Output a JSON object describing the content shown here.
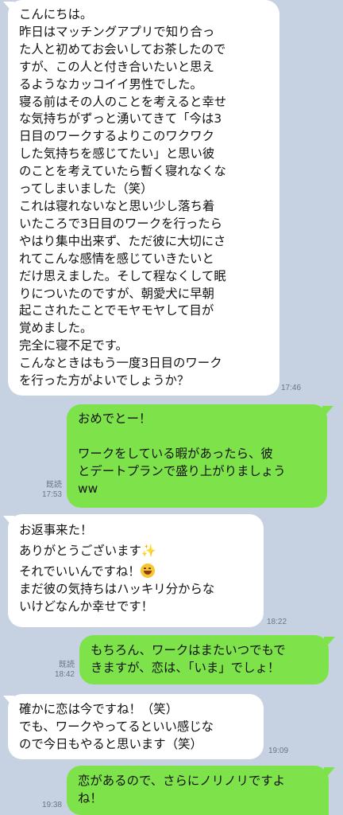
{
  "messages": [
    {
      "id": "m1",
      "direction": "incoming",
      "time": "17:46",
      "lines": [
        "こんにちは。",
        "昨日はマッチングアプリで知り合っ",
        "た人と初めてお会いしてお茶したので",
        "すが、この人と付き合いたいと思え",
        "るようなカッコイイ男性でした。",
        "寝る前はその人のことを考えると幸せ",
        "な気持ちがずっと湧いてきて「今は3",
        "日目のワークするよりこのワクワク",
        "した気持ちを感じてたい」と思い彼",
        "のことを考えていたら暫く寝れなくな",
        "ってしまいました（笑）",
        "これは寝れないなと思い少し落ち着",
        "いたころで3日目のワークを行ったら",
        "やはり集中出来ず、ただ彼に大切にさ",
        "れてこんな感情を感じていきたいと",
        "だけ思えました。そして程なくして眠",
        "りについたのですが、朝愛犬に早朝",
        "起こされたことでモヤモヤして目が",
        "覚めました。",
        "完全に寝不足です。",
        "こんなときはもう一度3日目のワーク",
        "を行った方がよいでしょうか？"
      ]
    },
    {
      "id": "m2",
      "direction": "outgoing",
      "read_label": "既読",
      "time": "17:53",
      "lines": [
        "おめでとー！",
        "",
        "ワークをしている暇があったら、彼",
        "とデートプランで盛り上がりましょう",
        "ww"
      ]
    },
    {
      "id": "m3",
      "direction": "incoming",
      "time": "18:22",
      "lines": [
        "お返事来た！",
        "ありがとうございます",
        "それでいいんですね！",
        "まだ彼の気持ちはハッキリ分からな",
        "いけどなんか幸せです！"
      ],
      "emojis": {
        "sparkles": "✨",
        "grin_sweat": "grinning-sweat-face"
      }
    },
    {
      "id": "m4",
      "direction": "outgoing",
      "read_label": "既読",
      "time": "18:42",
      "lines": [
        "もちろん、ワークはまたいつでもで",
        "きますが、恋は、「いま」でしょ！"
      ]
    },
    {
      "id": "m5",
      "direction": "incoming",
      "time": "19:09",
      "lines": [
        "確かに恋は今ですね！（笑）",
        "でも、ワークやってるといい感じな",
        "ので今日もやると思います（笑）"
      ]
    },
    {
      "id": "m6",
      "direction": "outgoing",
      "time": "19:38",
      "lines": [
        "恋があるので、さらにノリノリですよ",
        "ね！"
      ]
    }
  ],
  "colors": {
    "background": "#c6d2e1",
    "incoming_bubble": "#ffffff",
    "outgoing_bubble": "#7ee34b",
    "meta_text": "#6b7585"
  }
}
